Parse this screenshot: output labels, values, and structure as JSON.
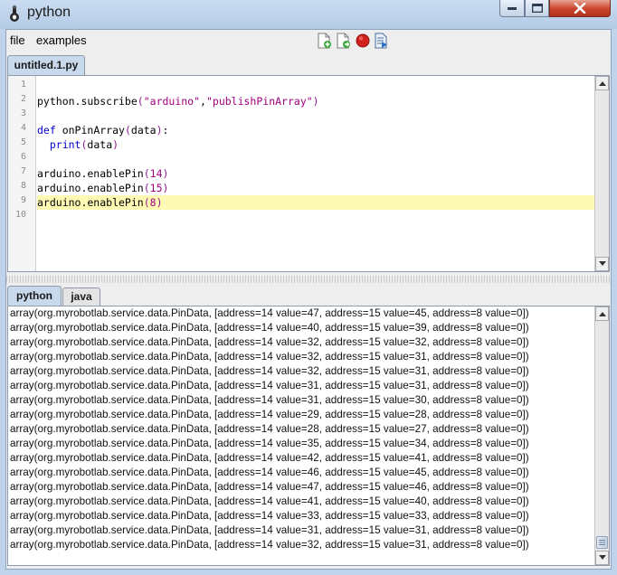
{
  "window": {
    "title": "python"
  },
  "menu": {
    "file": "file",
    "examples": "examples"
  },
  "toolbar": [
    "new-script-icon",
    "open-script-icon",
    "stop-icon",
    "run-script-icon"
  ],
  "editor": {
    "tab": "untitled.1.py",
    "current_line": 9,
    "line_numbers": [
      "1",
      "2",
      "3",
      "4",
      "5",
      "6",
      "7",
      "8",
      "9",
      "10"
    ],
    "lines": [
      [],
      [
        {
          "t": "python.subscribe"
        },
        {
          "t": "(",
          "c": "par"
        },
        {
          "t": "\"arduino\"",
          "c": "str"
        },
        {
          "t": ","
        },
        {
          "t": "\"publishPinArray\"",
          "c": "str"
        },
        {
          "t": ")",
          "c": "par"
        }
      ],
      [],
      [
        {
          "t": "def",
          "c": "kw"
        },
        {
          "t": " onPinArray"
        },
        {
          "t": "(",
          "c": "par"
        },
        {
          "t": "data"
        },
        {
          "t": ")",
          "c": "par"
        },
        {
          "t": ":"
        }
      ],
      [
        {
          "t": "  "
        },
        {
          "t": "print",
          "c": "kw"
        },
        {
          "t": "(",
          "c": "par"
        },
        {
          "t": "data"
        },
        {
          "t": ")",
          "c": "par"
        }
      ],
      [],
      [
        {
          "t": "arduino.enablePin"
        },
        {
          "t": "(",
          "c": "par"
        },
        {
          "t": "14",
          "c": "num"
        },
        {
          "t": ")",
          "c": "par"
        }
      ],
      [
        {
          "t": "arduino.enablePin"
        },
        {
          "t": "(",
          "c": "par"
        },
        {
          "t": "15",
          "c": "num"
        },
        {
          "t": ")",
          "c": "par"
        }
      ],
      [
        {
          "t": "arduino.enablePin"
        },
        {
          "t": "(",
          "c": "par"
        },
        {
          "t": "8",
          "c": "num"
        },
        {
          "t": ")",
          "c": "par"
        }
      ],
      []
    ]
  },
  "console": {
    "tabs": [
      "python",
      "java"
    ],
    "active_tab": "python",
    "lines": [
      "array(org.myrobotlab.service.data.PinData, [address=14 value=47, address=15 value=45, address=8 value=0])",
      "array(org.myrobotlab.service.data.PinData, [address=14 value=40, address=15 value=39, address=8 value=0])",
      "array(org.myrobotlab.service.data.PinData, [address=14 value=32, address=15 value=32, address=8 value=0])",
      "array(org.myrobotlab.service.data.PinData, [address=14 value=32, address=15 value=31, address=8 value=0])",
      "array(org.myrobotlab.service.data.PinData, [address=14 value=32, address=15 value=31, address=8 value=0])",
      "array(org.myrobotlab.service.data.PinData, [address=14 value=31, address=15 value=31, address=8 value=0])",
      "array(org.myrobotlab.service.data.PinData, [address=14 value=31, address=15 value=30, address=8 value=0])",
      "array(org.myrobotlab.service.data.PinData, [address=14 value=29, address=15 value=28, address=8 value=0])",
      "array(org.myrobotlab.service.data.PinData, [address=14 value=28, address=15 value=27, address=8 value=0])",
      "array(org.myrobotlab.service.data.PinData, [address=14 value=35, address=15 value=34, address=8 value=0])",
      "array(org.myrobotlab.service.data.PinData, [address=14 value=42, address=15 value=41, address=8 value=0])",
      "array(org.myrobotlab.service.data.PinData, [address=14 value=46, address=15 value=45, address=8 value=0])",
      "array(org.myrobotlab.service.data.PinData, [address=14 value=47, address=15 value=46, address=8 value=0])",
      "array(org.myrobotlab.service.data.PinData, [address=14 value=41, address=15 value=40, address=8 value=0])",
      "array(org.myrobotlab.service.data.PinData, [address=14 value=33, address=15 value=33, address=8 value=0])",
      "array(org.myrobotlab.service.data.PinData, [address=14 value=31, address=15 value=31, address=8 value=0])",
      "array(org.myrobotlab.service.data.PinData, [address=14 value=32, address=15 value=31, address=8 value=0])"
    ]
  }
}
